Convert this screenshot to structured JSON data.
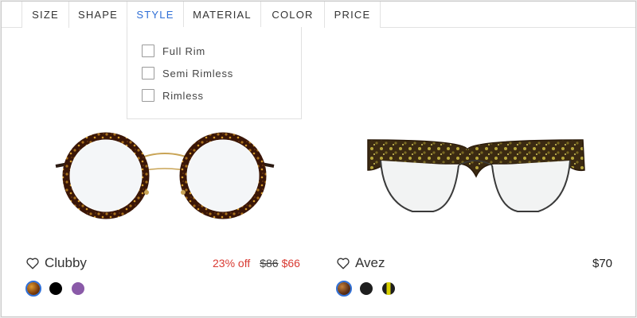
{
  "filters": {
    "tabs": [
      "SIZE",
      "SHAPE",
      "STYLE",
      "MATERIAL",
      "COLOR",
      "PRICE"
    ],
    "active_tab": "STYLE"
  },
  "style_dropdown": {
    "options": [
      "Full Rim",
      "Semi Rimless",
      "Rimless"
    ]
  },
  "products": [
    {
      "name": "Clubby",
      "discount": "23% off",
      "old_price": "$86",
      "new_price": "$66",
      "swatches": [
        "#7a3b0c",
        "#000000",
        "#8a5aa8"
      ],
      "selected_swatch": 0,
      "icon": "heart-icon"
    },
    {
      "name": "Avez",
      "price": "$70",
      "swatches": [
        "#5a2f18",
        "#1e1e1e",
        "#d8d000"
      ],
      "selected_swatch": 0,
      "icon": "heart-icon"
    }
  ],
  "colors": {
    "accent": "#2f6fd6",
    "sale": "#d93a32"
  }
}
